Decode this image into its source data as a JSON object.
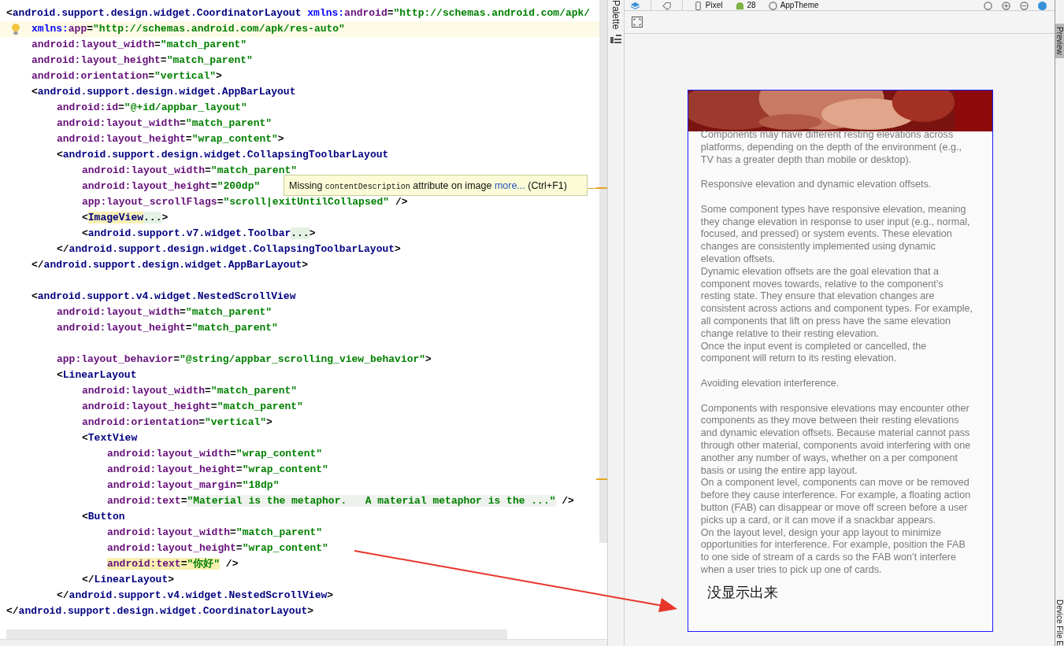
{
  "editor": {
    "lines": [
      {
        "kind": "code",
        "tokens": [
          {
            "kind": "punct",
            "text": "<"
          },
          {
            "kind": "tag",
            "text": "android.support.design.widget.CoordinatorLayout"
          },
          {
            "kind": "ns",
            "text": "xmlns:"
          },
          {
            "kind": "attr",
            "text": "android"
          },
          {
            "kind": "punct",
            "text": "="
          },
          {
            "kind": "value",
            "text": "\"http://schemas.android.com/apk/"
          }
        ],
        "children": [
          {
            "kind": "current",
            "tokens": [
              {
                "kind": "ns",
                "text": "xmlns:"
              },
              {
                "kind": "attr",
                "text": "app"
              },
              {
                "kind": "punct",
                "text": "="
              },
              {
                "kind": "value",
                "text": "\"http://schemas.android.com/apk/res-auto\""
              }
            ]
          },
          {
            "kind": "code",
            "tokens": [
              {
                "kind": "attr",
                "text": "android:layout_width"
              },
              {
                "kind": "punct",
                "text": "="
              },
              {
                "kind": "value",
                "text": "\"match_parent\""
              }
            ]
          },
          {
            "kind": "code",
            "tokens": [
              {
                "kind": "attr",
                "text": "android:layout_height"
              },
              {
                "kind": "punct",
                "text": "="
              },
              {
                "kind": "value",
                "text": "\"match_parent\""
              }
            ]
          },
          {
            "kind": "code",
            "tokens": [
              {
                "kind": "attr",
                "text": "android:orientation"
              },
              {
                "kind": "punct",
                "text": "="
              },
              {
                "kind": "value",
                "text": "\"vertical\""
              },
              {
                "kind": "punct",
                "text": ">"
              }
            ]
          },
          {
            "kind": "code",
            "tokens": [
              {
                "kind": "punct",
                "text": "<"
              },
              {
                "kind": "tag",
                "text": "android.support.design.widget.AppBarLayout"
              }
            ],
            "children": [
              {
                "kind": "code",
                "tokens": [
                  {
                    "kind": "attr",
                    "text": "android:id"
                  },
                  {
                    "kind": "punct",
                    "text": "="
                  },
                  {
                    "kind": "value",
                    "text": "\"@+id/appbar_layout\""
                  }
                ]
              },
              {
                "kind": "code",
                "tokens": [
                  {
                    "kind": "attr",
                    "text": "android:layout_width"
                  },
                  {
                    "kind": "punct",
                    "text": "="
                  },
                  {
                    "kind": "value",
                    "text": "\"match_parent\""
                  }
                ]
              },
              {
                "kind": "code",
                "tokens": [
                  {
                    "kind": "attr",
                    "text": "android:layout_height"
                  },
                  {
                    "kind": "punct",
                    "text": "="
                  },
                  {
                    "kind": "value",
                    "text": "\"wrap_content\""
                  },
                  {
                    "kind": "punct",
                    "text": ">"
                  }
                ]
              },
              {
                "kind": "code",
                "tokens": [
                  {
                    "kind": "punct",
                    "text": "<"
                  },
                  {
                    "kind": "tag",
                    "text": "android.support.design.widget.CollapsingToolbarLayout"
                  }
                ],
                "children": [
                  {
                    "kind": "code",
                    "tokens": [
                      {
                        "kind": "attr",
                        "text": "android:layout_width"
                      },
                      {
                        "kind": "punct",
                        "text": "="
                      },
                      {
                        "kind": "value",
                        "text": "\"match_parent\""
                      }
                    ]
                  },
                  {
                    "kind": "code",
                    "tokens": [
                      {
                        "kind": "attr",
                        "text": "android:layout_height"
                      },
                      {
                        "kind": "punct",
                        "text": "="
                      },
                      {
                        "kind": "value",
                        "text": "\"200dp\""
                      }
                    ]
                  },
                  {
                    "kind": "code",
                    "tokens": [
                      {
                        "kind": "attr",
                        "text": "app:layout_scrollFlags"
                      },
                      {
                        "kind": "punct",
                        "text": "="
                      },
                      {
                        "kind": "value",
                        "text": "\"scroll|exitUntilCollapsed\""
                      },
                      {
                        "kind": "punct",
                        "text": " />"
                      }
                    ]
                  },
                  {
                    "kind": "code",
                    "tokens": [
                      {
                        "kind": "punct",
                        "text": "<"
                      },
                      {
                        "kind": "tag",
                        "text": "ImageView",
                        "color": "#f6f0b4"
                      },
                      {
                        "kind": "punct",
                        "text": "...",
                        "color": "#e4f2e4"
                      },
                      {
                        "kind": "punct",
                        "text": ">"
                      }
                    ]
                  },
                  {
                    "kind": "code",
                    "tokens": [
                      {
                        "kind": "punct",
                        "text": "<"
                      },
                      {
                        "kind": "tag",
                        "text": "android.support.v7.widget.Toolbar"
                      },
                      {
                        "kind": "punct",
                        "text": "...",
                        "color": "#e4f2e4"
                      },
                      {
                        "kind": "punct",
                        "text": ">"
                      }
                    ]
                  }
                ]
              },
              {
                "kind": "code",
                "tokens": [
                  {
                    "kind": "punct",
                    "text": "</"
                  },
                  {
                    "kind": "tag",
                    "text": "android.support.design.widget.CollapsingToolbarLayout"
                  },
                  {
                    "kind": "punct",
                    "text": ">"
                  }
                ]
              }
            ]
          },
          {
            "kind": "code",
            "tokens": [
              {
                "kind": "punct",
                "text": "</"
              },
              {
                "kind": "tag",
                "text": "android.support.design.widget.AppBarLayout"
              },
              {
                "kind": "punct",
                "text": ">"
              }
            ]
          },
          {
            "kind": "blank"
          },
          {
            "kind": "code",
            "tokens": [
              {
                "kind": "punct",
                "text": "<"
              },
              {
                "kind": "tag",
                "text": "android.support.v4.widget.NestedScrollView"
              }
            ],
            "children": [
              {
                "kind": "code",
                "tokens": [
                  {
                    "kind": "attr",
                    "text": "android:layout_width"
                  },
                  {
                    "kind": "punct",
                    "text": "="
                  },
                  {
                    "kind": "value",
                    "text": "\"match_parent\""
                  }
                ]
              },
              {
                "kind": "code",
                "tokens": [
                  {
                    "kind": "attr",
                    "text": "android:layout_height"
                  },
                  {
                    "kind": "punct",
                    "text": "="
                  },
                  {
                    "kind": "value",
                    "text": "\"match_parent\""
                  }
                ]
              },
              {
                "kind": "blank"
              },
              {
                "kind": "code",
                "tokens": [
                  {
                    "kind": "attr",
                    "text": "app:layout_behavior"
                  },
                  {
                    "kind": "punct",
                    "text": "="
                  },
                  {
                    "kind": "value",
                    "text": "\"@string/appbar_scrolling_view_behavior\""
                  },
                  {
                    "kind": "punct",
                    "text": ">"
                  }
                ]
              },
              {
                "kind": "code",
                "tokens": [
                  {
                    "kind": "punct",
                    "text": "<"
                  },
                  {
                    "kind": "tag",
                    "text": "LinearLayout"
                  }
                ],
                "children": [
                  {
                    "kind": "code",
                    "tokens": [
                      {
                        "kind": "attr",
                        "text": "android:layout_width"
                      },
                      {
                        "kind": "punct",
                        "text": "="
                      },
                      {
                        "kind": "value",
                        "text": "\"match_parent\""
                      }
                    ]
                  },
                  {
                    "kind": "code",
                    "tokens": [
                      {
                        "kind": "attr",
                        "text": "android:layout_height"
                      },
                      {
                        "kind": "punct",
                        "text": "="
                      },
                      {
                        "kind": "value",
                        "text": "\"match_parent\""
                      }
                    ]
                  },
                  {
                    "kind": "code",
                    "tokens": [
                      {
                        "kind": "attr",
                        "text": "android:orientation"
                      },
                      {
                        "kind": "punct",
                        "text": "="
                      },
                      {
                        "kind": "value",
                        "text": "\"vertical\""
                      },
                      {
                        "kind": "punct",
                        "text": ">"
                      }
                    ]
                  },
                  {
                    "kind": "code",
                    "tokens": [
                      {
                        "kind": "punct",
                        "text": "<"
                      },
                      {
                        "kind": "tag",
                        "text": "TextView"
                      }
                    ],
                    "children": [
                      {
                        "kind": "code",
                        "tokens": [
                          {
                            "kind": "attr",
                            "text": "android:layout_width"
                          },
                          {
                            "kind": "punct",
                            "text": "="
                          },
                          {
                            "kind": "value",
                            "text": "\"wrap_content\""
                          }
                        ]
                      },
                      {
                        "kind": "code",
                        "tokens": [
                          {
                            "kind": "attr",
                            "text": "android:layout_height"
                          },
                          {
                            "kind": "punct",
                            "text": "="
                          },
                          {
                            "kind": "value",
                            "text": "\"wrap_content\""
                          }
                        ]
                      },
                      {
                        "kind": "code",
                        "tokens": [
                          {
                            "kind": "attr",
                            "text": "android:layout_margin"
                          },
                          {
                            "kind": "punct",
                            "text": "="
                          },
                          {
                            "kind": "value",
                            "text": "\"18dp\""
                          }
                        ]
                      },
                      {
                        "kind": "code",
                        "tokens": [
                          {
                            "kind": "attr",
                            "text": "android:text"
                          },
                          {
                            "kind": "punct",
                            "text": "="
                          },
                          {
                            "kind": "value",
                            "text": "\"Material is the metaphor.   A material metaphor is the ...\"",
                            "color": "#edf2ec"
                          },
                          {
                            "kind": "punct",
                            "text": " />"
                          }
                        ]
                      }
                    ]
                  },
                  {
                    "kind": "code",
                    "tokens": [
                      {
                        "kind": "punct",
                        "text": "<"
                      },
                      {
                        "kind": "tag",
                        "text": "Button"
                      }
                    ],
                    "children": [
                      {
                        "kind": "code",
                        "tokens": [
                          {
                            "kind": "attr",
                            "text": "android:layout_width"
                          },
                          {
                            "kind": "punct",
                            "text": "="
                          },
                          {
                            "kind": "value",
                            "text": "\"match_parent\""
                          }
                        ]
                      },
                      {
                        "kind": "code",
                        "tokens": [
                          {
                            "kind": "attr",
                            "text": "android:layout_height"
                          },
                          {
                            "kind": "punct",
                            "text": "="
                          },
                          {
                            "kind": "value",
                            "text": "\"wrap_content\""
                          }
                        ]
                      },
                      {
                        "kind": "code",
                        "tokens": [
                          {
                            "kind": "attr",
                            "text": "android:text",
                            "color": "#f8f0b0"
                          },
                          {
                            "kind": "punct",
                            "text": "=",
                            "color": "#f8f0b0"
                          },
                          {
                            "kind": "value",
                            "text": "\"你好\"",
                            "color": "#f8f0b0"
                          },
                          {
                            "kind": "punct",
                            "text": " />"
                          }
                        ]
                      }
                    ]
                  },
                  {
                    "kind": "code",
                    "tokens": [
                      {
                        "kind": "punct",
                        "text": "</"
                      },
                      {
                        "kind": "tag",
                        "text": "LinearLayout"
                      },
                      {
                        "kind": "punct",
                        "text": ">"
                      }
                    ]
                  }
                ]
              },
              {
                "kind": "code",
                "tokens": [
                  {
                    "kind": "punct",
                    "text": "</"
                  },
                  {
                    "kind": "tag",
                    "text": "android.support.v4.widget.NestedScrollView"
                  },
                  {
                    "kind": "punct",
                    "text": ">"
                  }
                ]
              }
            ]
          }
        ]
      },
      {
        "kind": "code",
        "tokens": [
          {
            "kind": "punct",
            "text": "</"
          },
          {
            "kind": "tag",
            "text": "android.support.design.widget.CoordinatorLayout"
          },
          {
            "kind": "punct",
            "text": ">"
          }
        ]
      }
    ],
    "tooltip": {
      "before": "Missing",
      "code": "contentDescription",
      "after": "attribute on image",
      "link": "more...",
      "shortcut": "(Ctrl+F1)"
    }
  },
  "palette_tab": "Palette",
  "toolbar": {
    "device": "Pixel",
    "api": "28",
    "theme": "AppTheme"
  },
  "preview": {
    "paragraphs": [
      {
        "blank_before": false,
        "text": "Components may have different resting elevations across platforms, depending on the depth of the environment (e.g., TV has a greater depth than mobile or desktop)."
      },
      {
        "blank_before": true,
        "text": "Responsive elevation and dynamic elevation offsets."
      },
      {
        "blank_before": true,
        "text": "Some component types have responsive elevation, meaning they change elevation in response to user input (e.g., normal, focused, and pressed) or system events. These elevation changes are consistently implemented using dynamic elevation offsets."
      },
      {
        "blank_before": false,
        "text": "Dynamic elevation offsets are the goal elevation that a component moves towards, relative to the component’s resting state. They ensure that elevation changes are consistent across actions and component types. For example, all components that lift on press have the same elevation change relative to their resting elevation."
      },
      {
        "blank_before": false,
        "text": "Once the input event is completed or cancelled, the component will return to its resting elevation."
      },
      {
        "blank_before": true,
        "text": "Avoiding elevation interference."
      },
      {
        "blank_before": true,
        "text": "Components with responsive elevations may encounter other components as they move between their resting elevations and dynamic elevation offsets. Because material cannot pass through other material, components avoid interfering with one another any number of ways, whether on a per component basis or using the entire app layout."
      },
      {
        "blank_before": false,
        "text": "On a component level, components can move or be removed before they cause interference. For example, a floating action button (FAB) can disappear or move off screen before a user picks up a card, or it can move if a snackbar appears."
      },
      {
        "blank_before": false,
        "text": "On the layout level, design your app layout to minimize opportunities for interference. For example, position the FAB to one side of stream of a cards so the FAB won’t interfere when a user tries to pick up one of cards."
      }
    ],
    "annotation": "没显示出来"
  },
  "side_tabs": [
    {
      "label": "Preview",
      "selected": true
    },
    {
      "label": "Device File E",
      "selected": false
    }
  ]
}
